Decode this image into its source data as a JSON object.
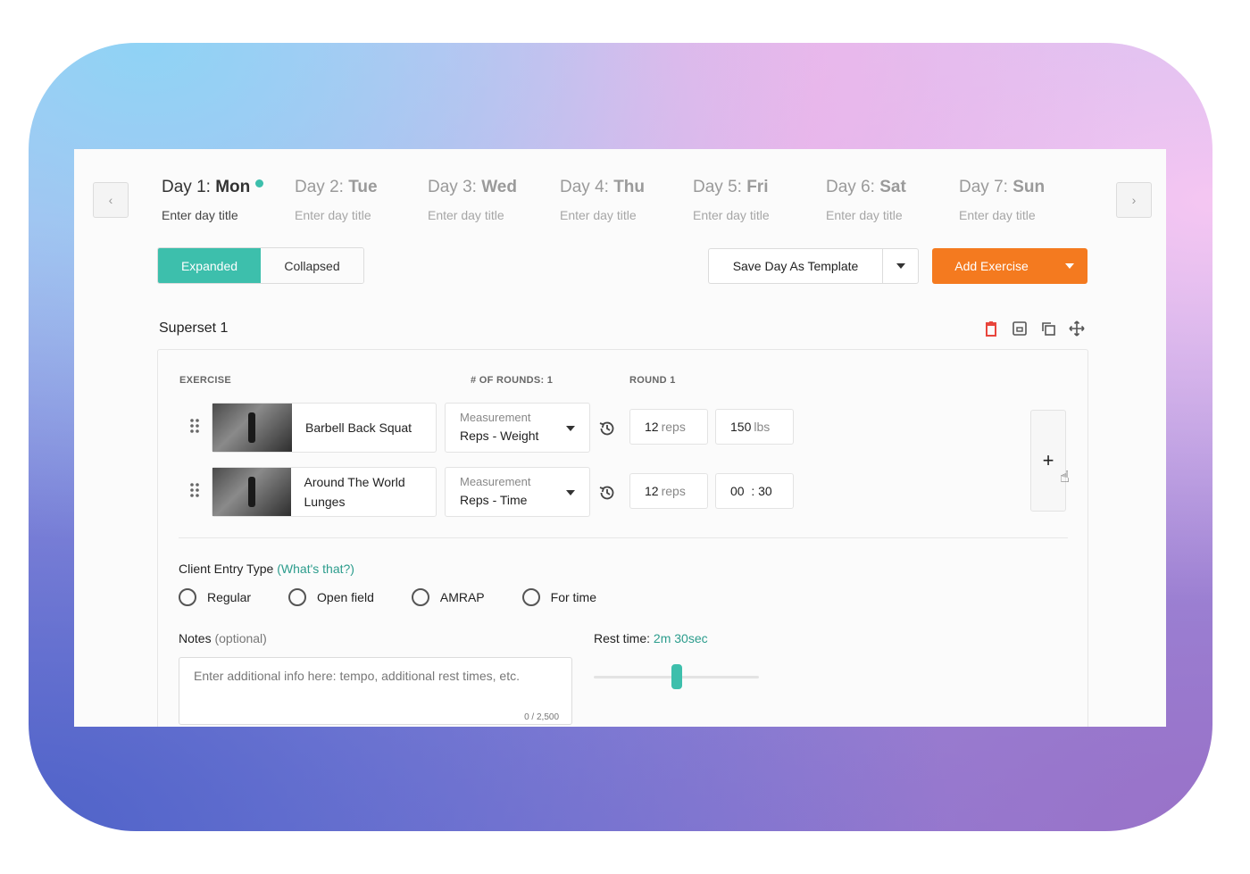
{
  "days": [
    {
      "label_prefix": "Day 1:",
      "label_day": "Mon",
      "title_placeholder": "Enter day title",
      "active": true
    },
    {
      "label_prefix": "Day 2:",
      "label_day": "Tue",
      "title_placeholder": "Enter day title",
      "active": false
    },
    {
      "label_prefix": "Day 3:",
      "label_day": "Wed",
      "title_placeholder": "Enter day title",
      "active": false
    },
    {
      "label_prefix": "Day 4:",
      "label_day": "Thu",
      "title_placeholder": "Enter day title",
      "active": false
    },
    {
      "label_prefix": "Day 5:",
      "label_day": "Fri",
      "title_placeholder": "Enter day title",
      "active": false
    },
    {
      "label_prefix": "Day 6:",
      "label_day": "Sat",
      "title_placeholder": "Enter day title",
      "active": false
    },
    {
      "label_prefix": "Day 7:",
      "label_day": "Sun",
      "title_placeholder": "Enter day title",
      "active": false
    }
  ],
  "nav": {
    "prev_glyph": "‹",
    "next_glyph": "›"
  },
  "view_toggle": {
    "expanded": "Expanded",
    "collapsed": "Collapsed",
    "selected": "Expanded"
  },
  "toolbar": {
    "save_template": "Save Day As Template",
    "add_exercise": "Add Exercise"
  },
  "superset": {
    "title": "Superset 1",
    "headers": {
      "exercise": "EXERCISE",
      "rounds": "# OF ROUNDS: 1",
      "round1": "ROUND 1"
    },
    "exercises": [
      {
        "name": "Barbell Back Squat",
        "measurement_label": "Measurement",
        "measurement_value": "Reps - Weight",
        "field1_value": "12",
        "field1_unit": "reps",
        "field2_value": "150",
        "field2_unit": "lbs"
      },
      {
        "name": "Around The World Lunges",
        "measurement_label": "Measurement",
        "measurement_value": "Reps - Time",
        "field1_value": "12",
        "field1_unit": "reps",
        "field2_value": "00  : 30",
        "field2_unit": ""
      }
    ],
    "add_round_glyph": "+"
  },
  "client_entry": {
    "label": "Client Entry Type",
    "help_link": "(What's that?)",
    "options": [
      "Regular",
      "Open field",
      "AMRAP",
      "For time"
    ]
  },
  "notes": {
    "label": "Notes",
    "optional": "(optional)",
    "placeholder": "Enter additional info here: tempo, additional rest times, etc.",
    "counter": "0 / 2,500"
  },
  "rest": {
    "label": "Rest time:",
    "value": "2m 30sec",
    "fraction": 0.5
  },
  "colors": {
    "accent": "#3dbfac",
    "primary": "#f47a1f",
    "danger": "#e8453c"
  }
}
